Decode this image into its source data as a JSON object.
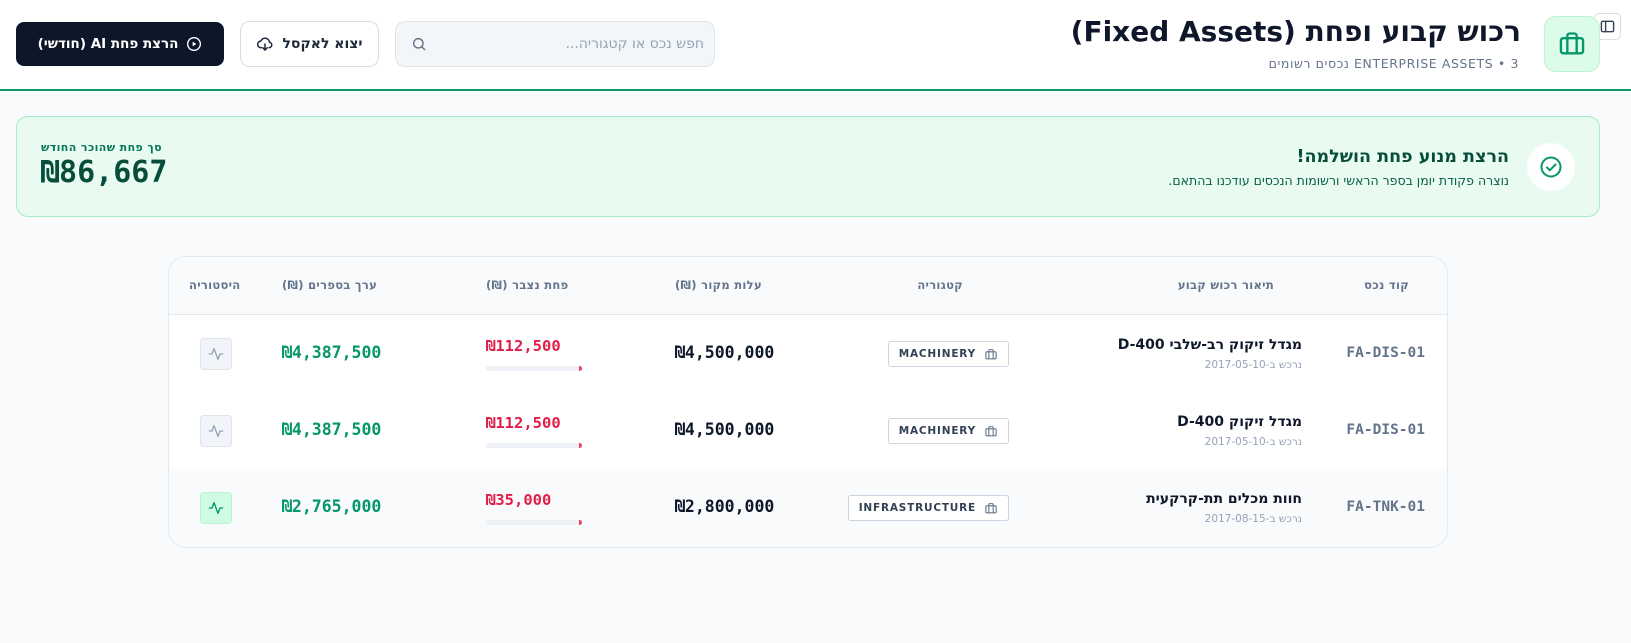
{
  "header": {
    "title": "רכוש קבוע ופחת (Fixed Assets)",
    "subtitle": "ENTERPRISE ASSETS • 3 נכסים רשומים",
    "search_placeholder": "חפש נכס או קטגוריה...",
    "export_label": "יצוא לאקסל",
    "run_label": "הרצת פחת AI (חודשי)",
    "icons": {
      "logo": "briefcase-icon",
      "corner": "sidebar-toggle-icon",
      "search": "search-icon",
      "export": "cloud-download-icon",
      "run": "play-circle-icon"
    }
  },
  "banner": {
    "title": "הרצת מנוע פחת הושלמה!",
    "text": "נוצרה פקודת יומן בספר הראשי ורשומות הנכסים עודכנו בהתאם.",
    "amount_label": "סך פחת שהוכר החודש",
    "amount": "₪86,667",
    "icon": "check-circle-icon"
  },
  "table": {
    "headers": {
      "code": "קוד נכס",
      "description": "תיאור רכוש קבוע",
      "category": "קטגוריה",
      "cost": "עלות מקור (₪)",
      "depreciation": "פחת נצבר (₪)",
      "book_value": "ערך בספרים (₪)",
      "history": "היסטוריה"
    },
    "rows": [
      {
        "code": "FA-DIS-01",
        "description": "מגדל זיקוק רב-שלבי D-400",
        "acquired": "נרכש ב-2017-05-10",
        "category": "MACHINERY",
        "cost": "₪4,500,000",
        "depreciation": "₪112,500",
        "dep_ratio": 0.025,
        "book_value": "₪4,387,500"
      },
      {
        "code": "FA-DIS-01",
        "description": "מגדל זיקוק D-400",
        "acquired": "נרכש ב-2017-05-10",
        "category": "MACHINERY",
        "cost": "₪4,500,000",
        "depreciation": "₪112,500",
        "dep_ratio": 0.025,
        "book_value": "₪4,387,500"
      },
      {
        "code": "FA-TNK-01",
        "description": "חוות מכלים תת-קרקעית",
        "acquired": "נרכש ב-2017-08-15",
        "category": "INFRASTRUCTURE",
        "cost": "₪2,800,000",
        "depreciation": "₪35,000",
        "dep_ratio": 0.0125,
        "book_value": "₪2,765,000"
      }
    ]
  },
  "colors": {
    "accent": "#10966b",
    "primary_dark": "#0e1729",
    "negative": "#e11d48",
    "positive": "#059669"
  }
}
